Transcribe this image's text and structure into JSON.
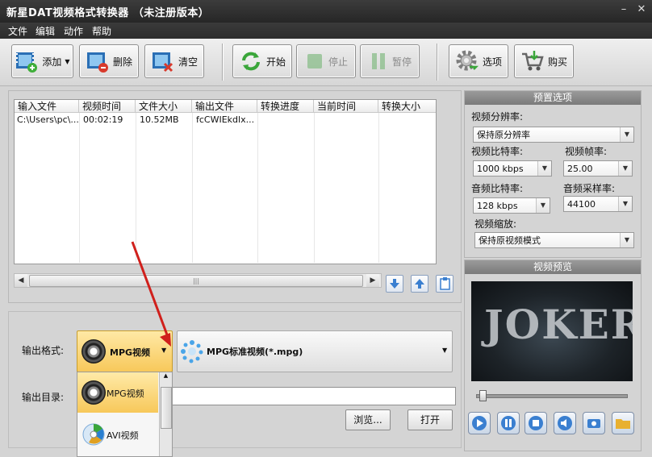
{
  "window": {
    "title": "新星DAT视频格式转换器 （未注册版本）",
    "minimize_glyph": "–",
    "close_glyph": "✕"
  },
  "menu": [
    "文件",
    "编辑",
    "动作",
    "帮助"
  ],
  "toolbar": {
    "add": "添加",
    "delete": "删除",
    "clear": "清空",
    "start": "开始",
    "stop": "停止",
    "pause": "暂停",
    "options": "选项",
    "buy": "购买"
  },
  "table": {
    "columns": [
      "输入文件",
      "视频时间",
      "文件大小",
      "输出文件",
      "转换进度",
      "当前时间",
      "转换大小"
    ],
    "rows": [
      [
        "C:\\Users\\pc\\...",
        "00:02:19",
        "10.52MB",
        "fcCWIEkdlx...",
        "",
        "",
        ""
      ]
    ]
  },
  "output": {
    "format_label": "输出格式:",
    "format_category": "MPG视频",
    "format_profile": "MPG标准视频(*.mpg)",
    "dir_label": "输出目录:",
    "dir_value": "",
    "browse": "浏览...",
    "open": "打开",
    "dropdown_items": [
      "MPG视频",
      "AVI视频"
    ]
  },
  "preset": {
    "title": "预置选项",
    "resolution_label": "视频分辨率:",
    "resolution_value": "保持原分辨率",
    "video_bitrate_label": "视频比特率:",
    "video_bitrate_value": "1000 kbps",
    "frame_rate_label": "视频帧率:",
    "frame_rate_value": "25.00",
    "audio_bitrate_label": "音频比特率:",
    "audio_bitrate_value": "128 kbps",
    "sample_rate_label": "音频采样率:",
    "sample_rate_value": "44100",
    "scaling_label": "视频缩放:",
    "scaling_value": "保持原视频模式"
  },
  "preview": {
    "title": "视频预览",
    "frame_text": "JOKER",
    "seek_position": 0.02
  },
  "colors": {
    "accent_format": "#f7c85a",
    "title_bar": "#2d2d2d",
    "panel_header": "#8a8a8a",
    "annotation_arrow": "#d0201c"
  },
  "icons": {
    "add": "film-add-icon",
    "delete": "film-delete-icon",
    "clear": "film-clear-icon",
    "start": "refresh-arrows-icon",
    "stop": "stop-icon",
    "pause": "pause-icon",
    "options": "gear-icon",
    "buy": "shopping-cart-icon"
  }
}
